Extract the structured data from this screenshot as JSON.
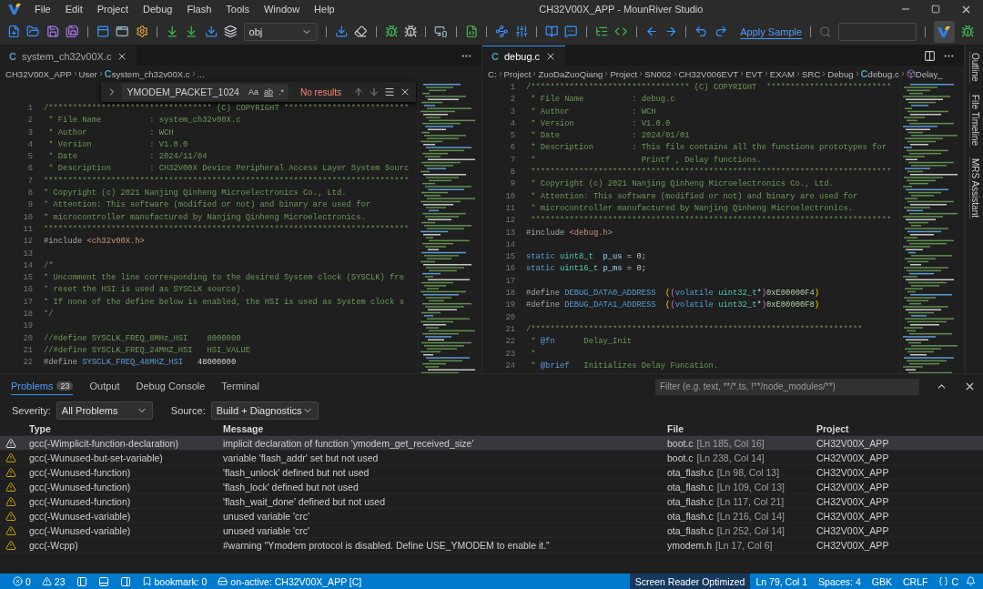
{
  "window": {
    "title": "CH32V00X_APP - MounRiver Studio",
    "menu": [
      "File",
      "Edit",
      "Project",
      "Debug",
      "Flash",
      "Tools",
      "Window",
      "Help"
    ]
  },
  "toolbar": {
    "target": "obj",
    "link": "Apply Sample"
  },
  "editors": [
    {
      "tab": {
        "badge": "C",
        "label": "system_ch32v00X.c",
        "selected": false
      },
      "breadcrumbs": [
        {
          "kind": "folder",
          "text": "CH32V00X_APP"
        },
        {
          "kind": "folder",
          "text": "User"
        },
        {
          "kind": "file",
          "badge": "C",
          "text": "system_ch32v00X.c"
        },
        {
          "kind": "folder",
          "text": "..."
        }
      ],
      "find": {
        "value": "YMODEM_PACKET_1024",
        "toggles": [
          "Aa",
          "ab",
          ".*"
        ],
        "status": "No results"
      },
      "lines": [
        {
          "number": "1",
          "parts": [
            {
              "kind": "comment",
              "text": "/********************************** (C) COPYRIGHT **************************"
            }
          ]
        },
        {
          "number": "2",
          "parts": [
            {
              "kind": "comment",
              "text": " * File Name          : system_ch32v00X.c"
            }
          ]
        },
        {
          "number": "3",
          "parts": [
            {
              "kind": "comment",
              "text": " * Author             : WCH"
            }
          ]
        },
        {
          "number": "4",
          "parts": [
            {
              "kind": "comment",
              "text": " * Version            : V1.0.0"
            }
          ]
        },
        {
          "number": "5",
          "parts": [
            {
              "kind": "comment",
              "text": " * Date               : 2024/11/04"
            }
          ]
        },
        {
          "number": "6",
          "parts": [
            {
              "kind": "comment",
              "text": " * Description        : CH32V00X Device Peripheral Access Layer System Sourc"
            }
          ]
        },
        {
          "number": "7",
          "parts": [
            {
              "kind": "comment",
              "text": "****************************************************************************"
            }
          ]
        },
        {
          "number": "8",
          "parts": [
            {
              "kind": "comment",
              "text": "* Copyright (c) 2021 Nanjing Qinheng Microelectronics Co., Ltd."
            }
          ]
        },
        {
          "number": "9",
          "parts": [
            {
              "kind": "comment",
              "text": "* Attention: This software (modified or not) and binary are used for"
            }
          ]
        },
        {
          "number": "10",
          "parts": [
            {
              "kind": "comment",
              "text": "* microcontroller manufactured by Nanjing Qinheng Microelectronics."
            }
          ]
        },
        {
          "number": "11",
          "parts": [
            {
              "kind": "comment",
              "text": "****************************************************************************"
            }
          ]
        },
        {
          "number": "12",
          "parts": [
            {
              "kind": "directive",
              "text": "#include "
            },
            {
              "kind": "string",
              "text": "<ch32v00X.h>"
            }
          ]
        },
        {
          "number": "13"
        },
        {
          "number": "14",
          "parts": [
            {
              "kind": "comment",
              "text": "/*"
            }
          ]
        },
        {
          "number": "15",
          "parts": [
            {
              "kind": "comment",
              "text": "* Uncomment the line corresponding to the desired System clock (SYSCLK) fre"
            }
          ]
        },
        {
          "number": "16",
          "parts": [
            {
              "kind": "comment",
              "text": "* reset the HSI is used as SYSCLK source)."
            }
          ]
        },
        {
          "number": "17",
          "parts": [
            {
              "kind": "comment",
              "text": "* If none of the define below is enabled, the HSI is used as System clock s"
            }
          ]
        },
        {
          "number": "18",
          "parts": [
            {
              "kind": "comment",
              "text": "*/"
            }
          ]
        },
        {
          "number": "19"
        },
        {
          "number": "20",
          "parts": [
            {
              "kind": "comment",
              "text": "//#define SYSCLK_FREQ_8MHz_HSI    8000000"
            }
          ]
        },
        {
          "number": "21",
          "parts": [
            {
              "kind": "comment",
              "text": "//#define SYSCLK_FREQ_24MHZ_HSI   HSI_VALUE"
            }
          ]
        },
        {
          "number": "22",
          "parts": [
            {
              "kind": "directive",
              "text": "#define "
            },
            {
              "kind": "macro",
              "text": "SYSCLK_FREQ_48MHZ_HSI"
            },
            {
              "kind": "plain",
              "text": "   48000000"
            }
          ]
        }
      ]
    },
    {
      "tab": {
        "badge": "C",
        "label": "debug.c",
        "selected": true
      },
      "breadcrumbs": [
        {
          "kind": "folder",
          "text": "C:"
        },
        {
          "kind": "folder",
          "text": "Project"
        },
        {
          "kind": "folder",
          "text": "ZuoDaZuoQiang"
        },
        {
          "kind": "folder",
          "text": "Project"
        },
        {
          "kind": "folder",
          "text": "SN002"
        },
        {
          "kind": "folder",
          "text": "CH32V006EVT"
        },
        {
          "kind": "folder",
          "text": "EVT"
        },
        {
          "kind": "folder",
          "text": "EXAM"
        },
        {
          "kind": "folder",
          "text": "SRC"
        },
        {
          "kind": "folder",
          "text": "Debug"
        },
        {
          "kind": "file",
          "badge": "C",
          "text": "debug.c"
        },
        {
          "kind": "symbol",
          "text": "Delay_"
        }
      ],
      "lines": [
        {
          "number": "1",
          "parts": [
            {
              "kind": "comment",
              "text": "/********************************* (C) COPYRIGHT  **************************"
            }
          ]
        },
        {
          "number": "2",
          "parts": [
            {
              "kind": "comment",
              "text": " * File Name          : debug.c"
            }
          ]
        },
        {
          "number": "3",
          "parts": [
            {
              "kind": "comment",
              "text": " * Author             : WCH"
            }
          ]
        },
        {
          "number": "4",
          "parts": [
            {
              "kind": "comment",
              "text": " * Version            : V1.0.0"
            }
          ]
        },
        {
          "number": "5",
          "parts": [
            {
              "kind": "comment",
              "text": " * Date               : 2024/01/01"
            }
          ]
        },
        {
          "number": "6",
          "parts": [
            {
              "kind": "comment",
              "text": " * Description        : This file contains all the functions prototypes for"
            }
          ]
        },
        {
          "number": "7",
          "parts": [
            {
              "kind": "comment",
              "text": " *                      Printf , Delay functions."
            }
          ]
        },
        {
          "number": "8",
          "parts": [
            {
              "kind": "comment",
              "text": " ***************************************************************************"
            }
          ]
        },
        {
          "number": "9",
          "parts": [
            {
              "kind": "comment",
              "text": " * Copyright (c) 2021 Nanjing Qinheng Microelectronics Co., Ltd."
            }
          ]
        },
        {
          "number": "10",
          "parts": [
            {
              "kind": "comment",
              "text": " * Attention: This software (modified or not) and binary are used for"
            }
          ]
        },
        {
          "number": "11",
          "parts": [
            {
              "kind": "comment",
              "text": " * microcontroller manufactured by Nanjing Qinheng Microelectronics."
            }
          ]
        },
        {
          "number": "12",
          "parts": [
            {
              "kind": "comment",
              "text": " ***************************************************************************"
            }
          ]
        },
        {
          "number": "13",
          "parts": [
            {
              "kind": "directive",
              "text": "#include "
            },
            {
              "kind": "string",
              "text": "<debug.h>"
            }
          ]
        },
        {
          "number": "14"
        },
        {
          "number": "15",
          "parts": [
            {
              "kind": "keyword",
              "text": "static "
            },
            {
              "kind": "type",
              "text": "uint8_t"
            },
            {
              "kind": "variable",
              "text": "  p_us"
            },
            {
              "kind": "plain",
              "text": " = "
            },
            {
              "kind": "number",
              "text": "0"
            },
            {
              "kind": "plain",
              "text": ";"
            }
          ]
        },
        {
          "number": "16",
          "parts": [
            {
              "kind": "keyword",
              "text": "static "
            },
            {
              "kind": "type",
              "text": "uint16_t"
            },
            {
              "kind": "variable",
              "text": " p_ms"
            },
            {
              "kind": "plain",
              "text": " = "
            },
            {
              "kind": "number",
              "text": "0"
            },
            {
              "kind": "plain",
              "text": ";"
            }
          ]
        },
        {
          "number": "17"
        },
        {
          "number": "18",
          "parts": [
            {
              "kind": "directive",
              "text": "#define "
            },
            {
              "kind": "macro",
              "text": "DEBUG_DATA0_ADDRESS"
            },
            {
              "kind": "bracket",
              "text": "  ("
            },
            {
              "kind": "bracket2",
              "text": "("
            },
            {
              "kind": "keyword",
              "text": "volatile "
            },
            {
              "kind": "type",
              "text": "uint32_t"
            },
            {
              "kind": "plain",
              "text": "*"
            },
            {
              "kind": "bracket2",
              "text": ")"
            },
            {
              "kind": "number",
              "text": "0xE00000F4"
            },
            {
              "kind": "bracket",
              "text": ")"
            }
          ]
        },
        {
          "number": "19",
          "parts": [
            {
              "kind": "directive",
              "text": "#define "
            },
            {
              "kind": "macro",
              "text": "DEBUG_DATA1_ADDRESS"
            },
            {
              "kind": "bracket",
              "text": "  ("
            },
            {
              "kind": "bracket2",
              "text": "("
            },
            {
              "kind": "keyword",
              "text": "volatile "
            },
            {
              "kind": "type",
              "text": "uint32_t"
            },
            {
              "kind": "plain",
              "text": "*"
            },
            {
              "kind": "bracket2",
              "text": ")"
            },
            {
              "kind": "number",
              "text": "0xE00000F8"
            },
            {
              "kind": "bracket",
              "text": ")"
            }
          ]
        },
        {
          "number": "20"
        },
        {
          "number": "21",
          "parts": [
            {
              "kind": "comment",
              "text": "/*********************************************************************"
            }
          ]
        },
        {
          "number": "22",
          "parts": [
            {
              "kind": "comment",
              "text": " * "
            },
            {
              "kind": "tag",
              "text": "@fn"
            },
            {
              "kind": "comment",
              "text": "      Delay_Init"
            }
          ]
        },
        {
          "number": "23",
          "parts": [
            {
              "kind": "comment",
              "text": " *"
            }
          ]
        },
        {
          "number": "24",
          "parts": [
            {
              "kind": "comment",
              "text": " * "
            },
            {
              "kind": "tag",
              "text": "@brief"
            },
            {
              "kind": "comment",
              "text": "   Initializes Delay Funcation."
            }
          ]
        }
      ]
    }
  ],
  "sidebar": [
    "Outline",
    "File Timeline",
    "MRS Assistant"
  ],
  "panel": {
    "tabs": [
      {
        "label": "Problems",
        "badge": "23",
        "selected": true
      },
      {
        "label": "Output",
        "selected": false
      },
      {
        "label": "Debug Console",
        "selected": false
      },
      {
        "label": "Terminal",
        "selected": false
      }
    ],
    "filter": {
      "placeholder": "Filter (e.g. text, **/*.ts, !**/node_modules/**)"
    },
    "severity": {
      "label": "Severity:",
      "value": "All Problems"
    },
    "source": {
      "label": "Source:",
      "value": "Build + Diagnostics"
    },
    "columns": [
      "Type",
      "Message",
      "File",
      "Project"
    ],
    "rows": [
      {
        "type": "gcc(-Wimplicit-function-declaration)",
        "message": "implicit declaration of function 'ymodem_get_received_size'",
        "file": "boot.c",
        "location": "[Ln 185, Col 16]",
        "project": "CH32V00X_APP",
        "selected": true
      },
      {
        "type": "gcc(-Wunused-but-set-variable)",
        "message": "variable 'flash_addr' set but not used",
        "file": "boot.c",
        "location": "[Ln 238, Col 14]",
        "project": "CH32V00X_APP",
        "selected": false
      },
      {
        "type": "gcc(-Wunused-function)",
        "message": "'flash_unlock' defined but not used",
        "file": "ota_flash.c",
        "location": "[Ln 98, Col 13]",
        "project": "CH32V00X_APP",
        "selected": false
      },
      {
        "type": "gcc(-Wunused-function)",
        "message": "'flash_lock' defined but not used",
        "file": "ota_flash.c",
        "location": "[Ln 109, Col 13]",
        "project": "CH32V00X_APP",
        "selected": false
      },
      {
        "type": "gcc(-Wunused-function)",
        "message": "'flash_wait_done' defined but not used",
        "file": "ota_flash.c",
        "location": "[Ln 117, Col 21]",
        "project": "CH32V00X_APP",
        "selected": false
      },
      {
        "type": "gcc(-Wunused-variable)",
        "message": "unused variable 'crc'",
        "file": "ota_flash.c",
        "location": "[Ln 216, Col 14]",
        "project": "CH32V00X_APP",
        "selected": false
      },
      {
        "type": "gcc(-Wunused-variable)",
        "message": "unused variable 'crc'",
        "file": "ota_flash.c",
        "location": "[Ln 252, Col 14]",
        "project": "CH32V00X_APP",
        "selected": false
      },
      {
        "type": "gcc(-Wcpp)",
        "message": "#warning \"Ymodem protocol is disabled. Define USE_YMODEM to enable it.\"",
        "file": "ymodem.h",
        "location": "[Ln 17, Col 6]",
        "project": "CH32V00X_APP",
        "selected": false
      }
    ]
  },
  "status_bar": {
    "errors": "0",
    "warnings": "23",
    "bookmark": "bookmark: 0",
    "active": "on-active: CH32V00X_APP [C]",
    "right": [
      {
        "text": "Screen Reader Optimized",
        "highlighted": true
      },
      {
        "text": "Ln 79, Col 1",
        "highlighted": false
      },
      {
        "text": "Spaces: 4",
        "highlighted": false
      },
      {
        "text": "GBK",
        "highlighted": false
      },
      {
        "text": "CRLF",
        "highlighted": false
      },
      {
        "text": "C",
        "kind": "language",
        "highlighted": false
      }
    ]
  }
}
